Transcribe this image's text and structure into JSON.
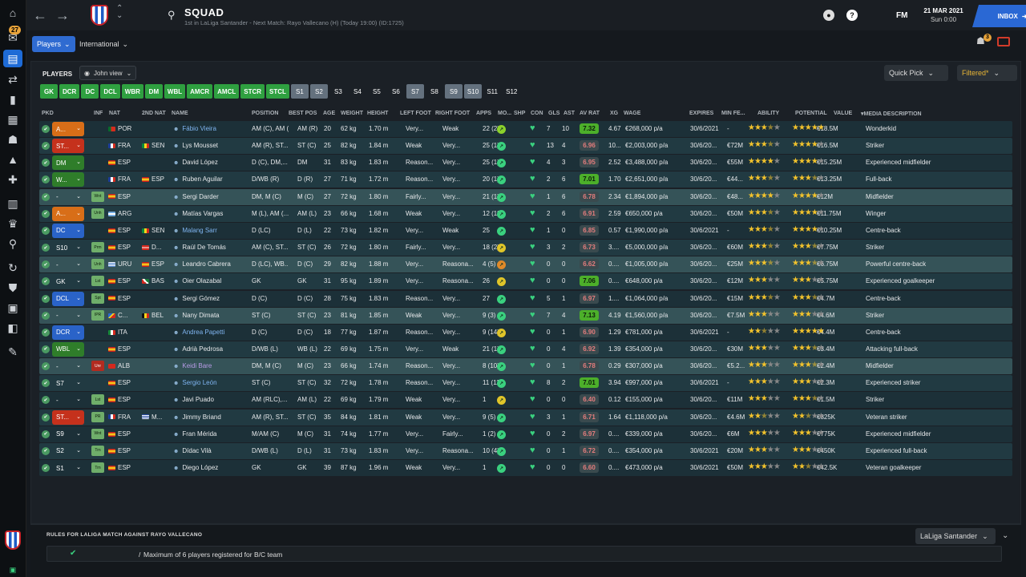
{
  "header": {
    "title": "SQUAD",
    "subtitle": "1st in LaLiga Santander - Next Match: Rayo Vallecano (H) (Today 19:00) (ID:1725)",
    "date": "21 MAR 2021",
    "time": "Sun 0:00",
    "fm": "FM",
    "inbox": "INBOX",
    "badge_count": "27",
    "notif_count": "3"
  },
  "subnav": {
    "players": "Players",
    "international": "International"
  },
  "panel": {
    "label": "PLAYERS",
    "view": "John view",
    "quick_pick": "Quick Pick",
    "filtered": "Filtered*"
  },
  "chips": [
    {
      "label": "GK",
      "style": "g"
    },
    {
      "label": "DCR",
      "style": "g"
    },
    {
      "label": "DC",
      "style": "g"
    },
    {
      "label": "DCL",
      "style": "g"
    },
    {
      "label": "WBR",
      "style": "g"
    },
    {
      "label": "DM",
      "style": "g"
    },
    {
      "label": "WBL",
      "style": "g"
    },
    {
      "label": "AMCR",
      "style": "g"
    },
    {
      "label": "AMCL",
      "style": "g"
    },
    {
      "label": "STCR",
      "style": "g"
    },
    {
      "label": "STCL",
      "style": "g"
    },
    {
      "label": "S1",
      "style": "s"
    },
    {
      "label": "S2",
      "style": "s"
    },
    {
      "label": "S3",
      "style": "n"
    },
    {
      "label": "S4",
      "style": "n"
    },
    {
      "label": "S5",
      "style": "n"
    },
    {
      "label": "S6",
      "style": "n"
    },
    {
      "label": "S7",
      "style": "s"
    },
    {
      "label": "S8",
      "style": "n"
    },
    {
      "label": "S9",
      "style": "s"
    },
    {
      "label": "S10",
      "style": "s"
    },
    {
      "label": "S11",
      "style": "n"
    },
    {
      "label": "S12",
      "style": "n"
    }
  ],
  "columns": {
    "pkd": "PKD",
    "inf": "INF",
    "nat": "NAT",
    "nat2": "2ND NAT",
    "name": "NAME",
    "position": "POSITION",
    "bestpos": "BEST POS",
    "age": "AGE",
    "weight": "WEIGHT",
    "height": "HEIGHT",
    "leftfoot": "LEFT FOOT",
    "rightfoot": "RIGHT FOOT",
    "apps": "APPS",
    "mo": "MO...",
    "shp": "SHP",
    "con": "CON",
    "gls": "GLS",
    "ast": "AST",
    "avrat": "AV RAT",
    "xg": "XG",
    "wage": "WAGE",
    "expires": "EXPIRES",
    "minfee": "MIN FE...",
    "ability": "ABILITY",
    "potential": "POTENTIAL",
    "value": "VALUE",
    "media": "MEDIA DESCRIPTION"
  },
  "colors": {
    "accent": "#2f6bd1",
    "chip_green": "#2fa040",
    "chip_grey": "#64717e",
    "gold_star": "#f3c32c",
    "morale_green": "#3ad17f"
  },
  "players": [
    {
      "role": "A...",
      "rc": "orange",
      "inf": "",
      "nat": "POR",
      "nat2": "",
      "name": "Fábio Vieira",
      "nc": "blue",
      "pos": "AM (C), AM (...",
      "best": "AM (R)",
      "age": "20",
      "wt": "62 kg",
      "ht": "1.70 m",
      "lf": "Very...",
      "rf": "Weak",
      "apps": "22 (2)",
      "mo": "#8bd12b",
      "gls": "7",
      "ast": "10",
      "av": "7.32",
      "avc": "green",
      "xg": "4.67",
      "wage": "€268,000 p/a",
      "exp": "30/6/2021",
      "fee": "-",
      "ab": "3.5",
      "pot": "5",
      "val": "€18.5M",
      "media": "Wonderkid"
    },
    {
      "role": "ST...",
      "rc": "red",
      "inf": "",
      "nat": "FRA",
      "nat2": "SEN",
      "name": "Lys Mousset",
      "nc": "",
      "pos": "AM (R), ST...",
      "best": "ST (C)",
      "age": "25",
      "wt": "82 kg",
      "ht": "1.84 m",
      "lf": "Weak",
      "rf": "Very...",
      "apps": "25 (1)",
      "mo": "#3ad17f",
      "gls": "13",
      "ast": "4",
      "av": "6.96",
      "avc": "dark",
      "xg": "10...",
      "wage": "€2,003,000 p/a",
      "exp": "30/6/20...",
      "fee": "€72M",
      "ab": "3.5",
      "pot": "4",
      "val": "€16.5M",
      "media": "Striker"
    },
    {
      "role": "DM",
      "rc": "green",
      "inf": "",
      "nat": "ESP",
      "nat2": "",
      "name": "David López",
      "nc": "",
      "pos": "D (C), DM,...",
      "best": "DM",
      "age": "31",
      "wt": "83 kg",
      "ht": "1.83 m",
      "lf": "Reason...",
      "rf": "Very...",
      "apps": "25 (1)",
      "mo": "#3ad17f",
      "gls": "4",
      "ast": "3",
      "av": "6.95",
      "avc": "dark",
      "xg": "2.52",
      "wage": "€3,488,000 p/a",
      "exp": "30/6/20...",
      "fee": "€55M",
      "ab": "4",
      "pot": "4",
      "val": "€15.25M",
      "media": "Experienced midfielder"
    },
    {
      "role": "W...",
      "rc": "green",
      "inf": "",
      "nat": "FRA",
      "nat2": "ESP",
      "name": "Ruben Aguilar",
      "nc": "",
      "pos": "D/WB (R)",
      "best": "D (R)",
      "age": "27",
      "wt": "71 kg",
      "ht": "1.72 m",
      "lf": "Reason...",
      "rf": "Very...",
      "apps": "20 (1)",
      "mo": "#3ad17f",
      "gls": "2",
      "ast": "6",
      "av": "7.01",
      "avc": "green",
      "xg": "1.70",
      "wage": "€2,651,000 p/a",
      "exp": "30/6/20...",
      "fee": "€44...",
      "ab": "3.5",
      "pot": "3.5",
      "val": "€13.25M",
      "media": "Full-back"
    },
    {
      "role": "-",
      "rc": "none",
      "inf": "Wnt",
      "infc": "",
      "nat": "ESP",
      "nat2": "",
      "name": "Sergi Darder",
      "nc": "",
      "pos": "DM, M (C)",
      "best": "M (C)",
      "age": "27",
      "wt": "72 kg",
      "ht": "1.80 m",
      "lf": "Fairly...",
      "rf": "Very...",
      "apps": "21 (1)",
      "mo": "#3ad17f",
      "gls": "1",
      "ast": "6",
      "av": "6.78",
      "avc": "dark",
      "xg": "2.34",
      "wage": "€1,894,000 p/a",
      "exp": "30/6/20...",
      "fee": "€48...",
      "ab": "4",
      "pot": "4",
      "val": "€12M",
      "media": "Midfielder",
      "hl": true
    },
    {
      "role": "A...",
      "rc": "orange",
      "inf": "Unh",
      "infc": "",
      "nat": "ARG",
      "nat2": "",
      "name": "Matías Vargas",
      "nc": "",
      "pos": "M (L), AM (...",
      "best": "AM (L)",
      "age": "23",
      "wt": "66 kg",
      "ht": "1.68 m",
      "lf": "Weak",
      "rf": "Very...",
      "apps": "12 (11)",
      "mo": "#3ad17f",
      "gls": "2",
      "ast": "6",
      "av": "6.91",
      "avc": "dark",
      "xg": "2.59",
      "wage": "€650,000 p/a",
      "exp": "30/6/20...",
      "fee": "€50M",
      "ab": "3.5",
      "pot": "4",
      "val": "€11.75M",
      "media": "Winger"
    },
    {
      "role": "DC",
      "rc": "blue",
      "inf": "",
      "nat": "ESP",
      "nat2": "SEN",
      "name": "Malang Sarr",
      "nc": "blue",
      "pos": "D (LC)",
      "best": "D (L)",
      "age": "22",
      "wt": "73 kg",
      "ht": "1.82 m",
      "lf": "Very...",
      "rf": "Weak",
      "apps": "25",
      "mo": "#3ad17f",
      "gls": "1",
      "ast": "0",
      "av": "6.85",
      "avc": "dark",
      "xg": "0.57",
      "wage": "€1,990,000 p/a",
      "exp": "30/6/2021",
      "fee": "-",
      "ab": "3.5",
      "pot": "4",
      "val": "€10.25M",
      "media": "Centre-back"
    },
    {
      "role": "S10",
      "rc": "none",
      "inf": "Prm",
      "infc": "",
      "nat": "ESP",
      "nat2": "D...",
      "name": "Raúl De Tomás",
      "nc": "",
      "pos": "AM (C), ST...",
      "best": "ST (C)",
      "age": "26",
      "wt": "72 kg",
      "ht": "1.80 m",
      "lf": "Fairly...",
      "rf": "Very...",
      "apps": "18 (2)",
      "mo": "#e0c529",
      "gls": "3",
      "ast": "2",
      "av": "6.73",
      "avc": "dark",
      "xg": "3....",
      "wage": "€5,000,000 p/a",
      "exp": "30/6/20...",
      "fee": "€60M",
      "ab": "3.5",
      "pot": "3.5",
      "val": "€7.75M",
      "media": "Striker"
    },
    {
      "role": "-",
      "rc": "none",
      "inf": "Unh",
      "infc": "",
      "nat": "URU",
      "nat2": "ESP",
      "name": "Leandro Cabrera",
      "nc": "",
      "pos": "D (LC), WB...",
      "best": "D (C)",
      "age": "29",
      "wt": "82 kg",
      "ht": "1.88 m",
      "lf": "Very...",
      "rf": "Reasona...",
      "apps": "4 (5)",
      "mo": "#e08a29",
      "gls": "0",
      "ast": "0",
      "av": "6.62",
      "avc": "dark",
      "xg": "0....",
      "wage": "€1,005,000 p/a",
      "exp": "30/6/20...",
      "fee": "€25M",
      "ab": "3.5",
      "pot": "3.5",
      "val": "€6.75M",
      "media": "Powerful centre-back",
      "hl": true
    },
    {
      "role": "GK",
      "rc": "none",
      "inf": "Lst",
      "infc": "",
      "nat": "ESP",
      "nat2": "BAS",
      "name": "Oier Olazabal",
      "nc": "",
      "pos": "GK",
      "best": "GK",
      "age": "31",
      "wt": "95 kg",
      "ht": "1.89 m",
      "lf": "Very...",
      "rf": "Reasona...",
      "apps": "26",
      "mo": "#e0c529",
      "gls": "0",
      "ast": "0",
      "av": "7.06",
      "avc": "green",
      "xg": "0....",
      "wage": "€648,000 p/a",
      "exp": "30/6/20...",
      "fee": "€12M",
      "ab": "3",
      "pot": "3",
      "val": "€5.75M",
      "media": "Experienced goalkeeper"
    },
    {
      "role": "DCL",
      "rc": "blue",
      "inf": "Spt",
      "infc": "",
      "nat": "ESP",
      "nat2": "",
      "name": "Sergi Gómez",
      "nc": "",
      "pos": "D (C)",
      "best": "D (C)",
      "age": "28",
      "wt": "75 kg",
      "ht": "1.83 m",
      "lf": "Reason...",
      "rf": "Very...",
      "apps": "27",
      "mo": "#3ad17f",
      "gls": "5",
      "ast": "1",
      "av": "6.97",
      "avc": "dark",
      "xg": "1....",
      "wage": "€1,064,000 p/a",
      "exp": "30/6/20...",
      "fee": "€15M",
      "ab": "3.5",
      "pot": "3.5",
      "val": "€4.7M",
      "media": "Centre-back"
    },
    {
      "role": "-",
      "rc": "none",
      "inf": "IPR",
      "infc": "",
      "nat": "C...",
      "nat2": "BEL",
      "name": "Nany Dimata",
      "nc": "",
      "pos": "ST (C)",
      "best": "ST (C)",
      "age": "23",
      "wt": "81 kg",
      "ht": "1.85 m",
      "lf": "Weak",
      "rf": "Very...",
      "apps": "9 (3)",
      "mo": "#3ad17f",
      "gls": "7",
      "ast": "4",
      "av": "7.13",
      "avc": "green",
      "xg": "4.19",
      "wage": "€1,560,000 p/a",
      "exp": "30/6/20...",
      "fee": "€7.5M",
      "ab": "3",
      "pot": "3",
      "val": "€4.6M",
      "media": "Striker",
      "hl": true
    },
    {
      "role": "DCR",
      "rc": "blue",
      "inf": "",
      "nat": "ITA",
      "nat2": "",
      "name": "Andrea Papetti",
      "nc": "blue",
      "pos": "D (C)",
      "best": "D (C)",
      "age": "18",
      "wt": "77 kg",
      "ht": "1.87 m",
      "lf": "Reason...",
      "rf": "Very...",
      "apps": "9 (14)",
      "mo": "#e0c529",
      "gls": "0",
      "ast": "1",
      "av": "6.90",
      "avc": "dark",
      "xg": "1.29",
      "wage": "€781,000 p/a",
      "exp": "30/6/2021",
      "fee": "-",
      "ab": "2.5",
      "pot": "5",
      "val": "€4.4M",
      "media": "Centre-back"
    },
    {
      "role": "WBL",
      "rc": "green",
      "inf": "",
      "nat": "ESP",
      "nat2": "",
      "name": "Adrià Pedrosa",
      "nc": "",
      "pos": "D/WB (L)",
      "best": "WB (L)",
      "age": "22",
      "wt": "69 kg",
      "ht": "1.75 m",
      "lf": "Very...",
      "rf": "Weak",
      "apps": "21 (1)",
      "mo": "#3ad17f",
      "gls": "0",
      "ast": "4",
      "av": "6.92",
      "avc": "dark",
      "xg": "1.39",
      "wage": "€354,000 p/a",
      "exp": "30/6/20...",
      "fee": "€30M",
      "ab": "3",
      "pot": "3.5",
      "val": "€3.4M",
      "media": "Attacking full-back"
    },
    {
      "role": "-",
      "rc": "none",
      "inf": "Unr",
      "infc": "red",
      "nat": "ALB",
      "nat2": "",
      "name": "Keidi Bare",
      "nc": "purple",
      "pos": "DM, M (C)",
      "best": "M (C)",
      "age": "23",
      "wt": "66 kg",
      "ht": "1.74 m",
      "lf": "Reason...",
      "rf": "Very...",
      "apps": "8 (10)",
      "mo": "#3ad17f",
      "gls": "0",
      "ast": "1",
      "av": "6.78",
      "avc": "dark",
      "xg": "0.29",
      "wage": "€307,000 p/a",
      "exp": "30/6/20...",
      "fee": "€5.2...",
      "ab": "3",
      "pot": "3.5",
      "val": "€2.4M",
      "media": "Midfielder",
      "hl": true
    },
    {
      "role": "S7",
      "rc": "none",
      "inf": "",
      "nat": "ESP",
      "nat2": "",
      "name": "Sergio León",
      "nc": "blue",
      "pos": "ST (C)",
      "best": "ST (C)",
      "age": "32",
      "wt": "72 kg",
      "ht": "1.78 m",
      "lf": "Reason...",
      "rf": "Very...",
      "apps": "11 (11)",
      "mo": "#3ad17f",
      "gls": "8",
      "ast": "2",
      "av": "7.01",
      "avc": "green",
      "xg": "3.94",
      "wage": "€997,000 p/a",
      "exp": "30/6/2021",
      "fee": "-",
      "ab": "3",
      "pot": "3",
      "val": "€2.3M",
      "media": "Experienced striker"
    },
    {
      "role": "-",
      "rc": "none",
      "inf": "Lst",
      "infc": "",
      "nat": "ESP",
      "nat2": "",
      "name": "Javi Puado",
      "nc": "",
      "pos": "AM (RLC),...",
      "best": "AM (L)",
      "age": "22",
      "wt": "69 kg",
      "ht": "1.79 m",
      "lf": "Weak",
      "rf": "Very...",
      "apps": "1",
      "mo": "#e0c529",
      "gls": "0",
      "ast": "0",
      "av": "6.40",
      "avc": "dark",
      "xg": "0.12",
      "wage": "€155,000 p/a",
      "exp": "30/6/20...",
      "fee": "€11M",
      "ab": "3",
      "pot": "3.5",
      "val": "€1.5M",
      "media": "Striker"
    },
    {
      "role": "ST...",
      "rc": "red",
      "inf": "PR",
      "infc": "",
      "nat": "FRA",
      "nat2": "M...",
      "name": "Jimmy Briand",
      "nc": "",
      "pos": "AM (R), ST...",
      "best": "ST (C)",
      "age": "35",
      "wt": "84 kg",
      "ht": "1.81 m",
      "lf": "Weak",
      "rf": "Very...",
      "apps": "9 (5)",
      "mo": "#3ad17f",
      "gls": "3",
      "ast": "1",
      "av": "6.71",
      "avc": "dark",
      "xg": "1.64",
      "wage": "€1,118,000 p/a",
      "exp": "30/6/20...",
      "fee": "€4.6M",
      "ab": "2.5",
      "pot": "2.5",
      "val": "€825K",
      "media": "Veteran striker"
    },
    {
      "role": "S9",
      "rc": "none",
      "inf": "Wnt",
      "infc": "",
      "nat": "ESP",
      "nat2": "",
      "name": "Fran Mérida",
      "nc": "",
      "pos": "M/AM (C)",
      "best": "M (C)",
      "age": "31",
      "wt": "74 kg",
      "ht": "1.77 m",
      "lf": "Very...",
      "rf": "Fairly...",
      "apps": "1 (2)",
      "mo": "#3ad17f",
      "gls": "0",
      "ast": "2",
      "av": "6.97",
      "avc": "dark",
      "xg": "0....",
      "wage": "€339,000 p/a",
      "exp": "30/6/20...",
      "fee": "€6M",
      "ab": "3",
      "pot": "3",
      "val": "€775K",
      "media": "Experienced midfielder"
    },
    {
      "role": "S2",
      "rc": "none",
      "inf": "Trn",
      "infc": "",
      "nat": "ESP",
      "nat2": "",
      "name": "Dídac Vilà",
      "nc": "",
      "pos": "D/WB (L)",
      "best": "D (L)",
      "age": "31",
      "wt": "73 kg",
      "ht": "1.83 m",
      "lf": "Very...",
      "rf": "Reasona...",
      "apps": "10 (4)",
      "mo": "#3ad17f",
      "gls": "0",
      "ast": "1",
      "av": "6.72",
      "avc": "dark",
      "xg": "0....",
      "wage": "€354,000 p/a",
      "exp": "30/6/2021",
      "fee": "€20M",
      "ab": "3",
      "pot": "3",
      "val": "€450K",
      "media": "Experienced full-back"
    },
    {
      "role": "S1",
      "rc": "none",
      "inf": "Trn",
      "infc": "",
      "nat": "ESP",
      "nat2": "",
      "name": "Diego López",
      "nc": "",
      "pos": "GK",
      "best": "GK",
      "age": "39",
      "wt": "87 kg",
      "ht": "1.96 m",
      "lf": "Weak",
      "rf": "Very...",
      "apps": "1",
      "mo": "#3ad17f",
      "gls": "0",
      "ast": "0",
      "av": "6.60",
      "avc": "dark",
      "xg": "0....",
      "wage": "€473,000 p/a",
      "exp": "30/6/2021",
      "fee": "€50M",
      "ab": "3",
      "pot": "2.5",
      "val": "€42.5K",
      "media": "Veteran goalkeeper"
    }
  ],
  "rules": {
    "title": "RULES FOR LALIGA MATCH AGAINST RAYO VALLECANO",
    "text": "Maximum of 6 players registered for B/C team",
    "league": "LaLiga Santander"
  }
}
